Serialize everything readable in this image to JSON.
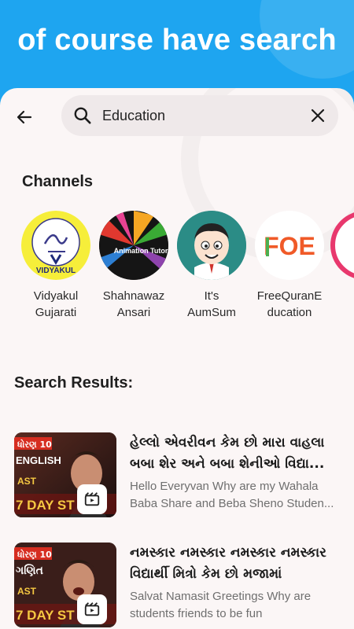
{
  "banner": {
    "title": "of course have search"
  },
  "search": {
    "value": "Education",
    "placeholder": ""
  },
  "channels_section": {
    "title": "Channels",
    "items": [
      {
        "line1": "Vidyakul",
        "line2": "Gujarati",
        "avatar_text": "VIDYAKUL"
      },
      {
        "line1": "Shahnawaz",
        "line2": "Ansari",
        "avatar_text": "Animation Tutorial"
      },
      {
        "line1": "It's",
        "line2": "AumSum",
        "avatar_text": ""
      },
      {
        "line1": "FreeQuranE",
        "line2": "ducation",
        "avatar_text": "FOE"
      }
    ]
  },
  "results_section": {
    "title": "Search Results:",
    "items": [
      {
        "title_line1": "હેલ્લો એવરીવન કેમ છો મારા વાહલા",
        "title_line2": "બબા શેર અને બબા શેનીઓ વિદ્યા...",
        "desc_line1": "Hello Everyvan Why are my Wahala",
        "desc_line2": "Baba Share and Beba Sheno Studen...",
        "thumb_top": "ધોરણ 10",
        "thumb_mid": "ENGLISH",
        "thumb_small": "AST",
        "thumb_bottom": "7 DAY ST"
      },
      {
        "title_line1": "નમસ્કાર નમસ્કાર નમસ્કાર નમસ્કાર",
        "title_line2": "વિદ્યાર્થી મિત્રો કેમ છો મજામાં",
        "desc_line1": "Salvat Namasit Greetings Why are",
        "desc_line2": "students friends to be fun",
        "thumb_top": "ધોરણ 10",
        "thumb_mid": "ગણિત",
        "thumb_small": "AST",
        "thumb_bottom": "7 DAY ST"
      }
    ]
  },
  "colors": {
    "banner": "#1ea5f0",
    "sheet": "#fbf6f6",
    "search_bg": "#efe9ea"
  },
  "icons": [
    "back-arrow-icon",
    "search-icon",
    "clear-icon",
    "shorts-icon"
  ]
}
